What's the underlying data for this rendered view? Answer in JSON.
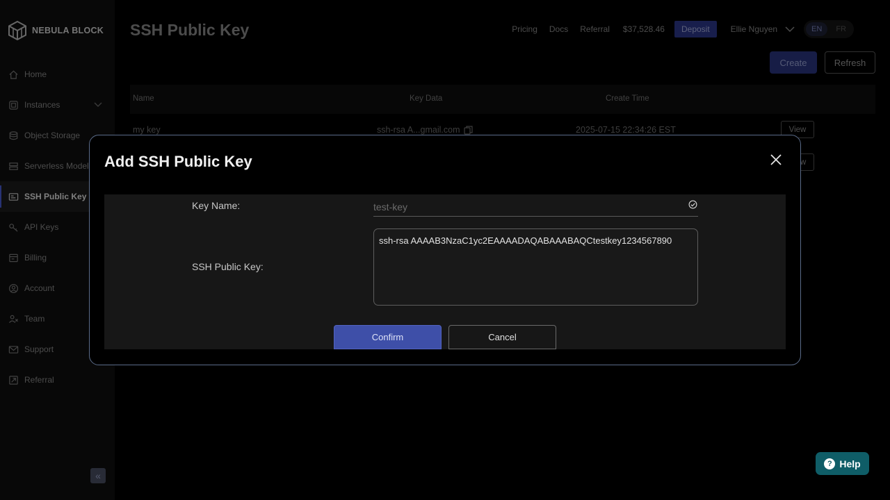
{
  "brand": {
    "name": "NEBULA BLOCK"
  },
  "sidebar": {
    "items": [
      {
        "label": "Home",
        "icon": "home-icon"
      },
      {
        "label": "Instances",
        "icon": "instances-icon"
      },
      {
        "label": "Object Storage",
        "icon": "database-icon"
      },
      {
        "label": "Serverless Models",
        "icon": "serverless-icon"
      },
      {
        "label": "SSH Public Key",
        "icon": "ssh-key-icon",
        "active": true
      },
      {
        "label": "API Keys",
        "icon": "key-icon"
      },
      {
        "label": "Billing",
        "icon": "billing-icon"
      },
      {
        "label": "Account",
        "icon": "account-icon"
      },
      {
        "label": "Team",
        "icon": "team-icon"
      },
      {
        "label": "Support",
        "icon": "mail-icon"
      },
      {
        "label": "Referral",
        "icon": "referral-icon"
      }
    ],
    "collapse_glyph": "«"
  },
  "header": {
    "title": "SSH Public Key",
    "links": [
      "Pricing",
      "Docs",
      "Referral"
    ],
    "balance": "$37,528.46",
    "deposit_label": "Deposit",
    "user_name": "Ellie Nguyen",
    "languages": [
      "EN",
      "FR"
    ],
    "active_language": "EN"
  },
  "toolbar": {
    "create_label": "Create",
    "refresh_label": "Refresh"
  },
  "table": {
    "columns": [
      "Name",
      "Key Data",
      "Create Time"
    ],
    "rows": [
      {
        "name": "my key",
        "key_data": "ssh-rsa A...gmail.com",
        "create_time": "2025-07-15 22:34:26 EST",
        "action": "View"
      },
      {
        "name": "",
        "key_data": "",
        "create_time": "",
        "action": "View"
      }
    ]
  },
  "modal": {
    "title": "Add SSH Public Key",
    "key_name_label": "Key Name:",
    "key_name_placeholder": "test-key",
    "key_name_value": "",
    "ssh_key_label": "SSH Public Key:",
    "ssh_key_value": "ssh-rsa AAAAB3NzaC1yc2EAAAADAQABAAABAQCtestkey1234567890",
    "confirm_label": "Confirm",
    "cancel_label": "Cancel"
  },
  "help": {
    "label": "Help",
    "glyph": "?"
  },
  "colors": {
    "accent": "#3e4fa8",
    "deposit": "#2c378a",
    "help": "#0f5d67",
    "modal_border": "#5b6c8a"
  }
}
